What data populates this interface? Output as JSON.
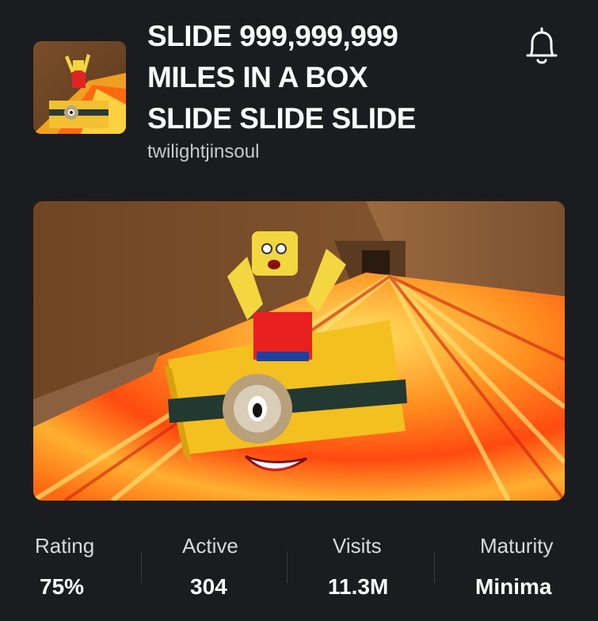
{
  "game": {
    "title_lines": [
      "SLIDE 999,999,999",
      "MILES IN A BOX",
      "SLIDE SLIDE SLIDE"
    ],
    "creator": "twilightjinsoul"
  },
  "icons": {
    "notify": "bell-icon"
  },
  "stats": [
    {
      "label": "Rating",
      "value": "75%"
    },
    {
      "label": "Active",
      "value": "304"
    },
    {
      "label": "Visits",
      "value": "11.3M"
    },
    {
      "label": "Maturity",
      "value": "Minima"
    }
  ],
  "colors": {
    "background": "#1b1c20",
    "text": "#ffffff",
    "muted_text": "#c8c9cd",
    "divider": "#3b3c42"
  }
}
